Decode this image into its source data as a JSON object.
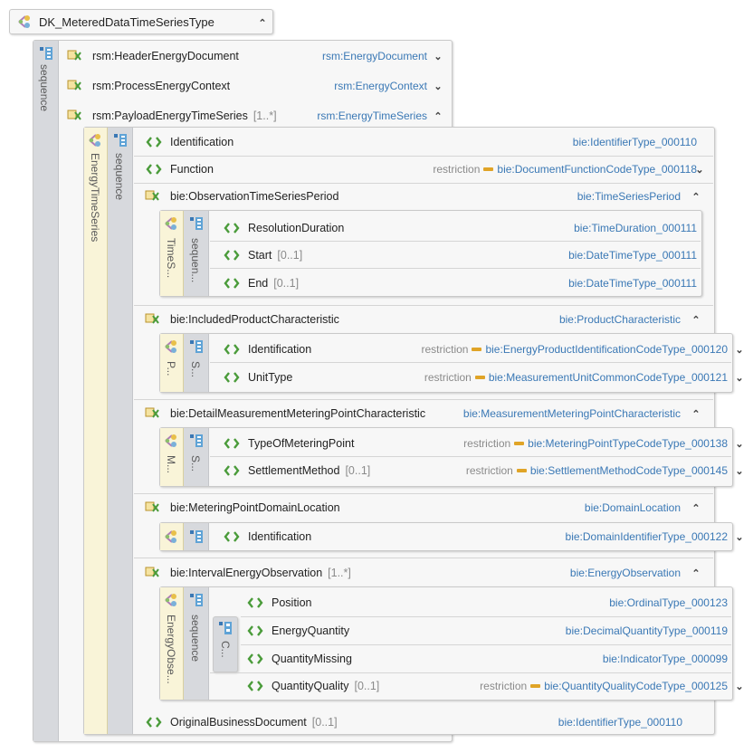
{
  "root": {
    "title": "DK_MeteredDataTimeSeriesType",
    "compositor": "sequence"
  },
  "top_elements": [
    {
      "name": "rsm:HeaderEnergyDocument",
      "mult": "",
      "type": "rsm:EnergyDocument",
      "chevron": "expand"
    },
    {
      "name": "rsm:ProcessEnergyContext",
      "mult": "",
      "type": "rsm:EnergyContext",
      "chevron": "expand"
    },
    {
      "name": "rsm:PayloadEnergyTimeSeries",
      "mult": "[1..*]",
      "type": "rsm:EnergyTimeSeries",
      "chevron": "collapse"
    }
  ],
  "payload": {
    "type_label": "EnergyTimeSeries",
    "compositor": "sequence",
    "rows": [
      {
        "name": "Identification",
        "mult": "",
        "restriction": "",
        "type": "bie:IdentifierType_000110",
        "chevron": ""
      },
      {
        "name": "Function",
        "mult": "",
        "restriction": "restriction",
        "type": "bie:DocumentFunctionCodeType_000118",
        "chevron": "expand"
      },
      {
        "name": "bie:ObservationTimeSeriesPeriod",
        "mult": "",
        "restriction": "",
        "type": "bie:TimeSeriesPeriod",
        "chevron": "collapse"
      }
    ],
    "period": {
      "type_label": "TimeS...",
      "compositor": "sequen...",
      "rows": [
        {
          "name": "ResolutionDuration",
          "mult": "",
          "type": "bie:TimeDuration_000111"
        },
        {
          "name": "Start",
          "mult": "[0..1]",
          "type": "bie:DateTimeType_000111"
        },
        {
          "name": "End",
          "mult": "[0..1]",
          "type": "bie:DateTimeType_000111"
        }
      ]
    },
    "product": {
      "name": "bie:IncludedProductCharacteristic",
      "type": "bie:ProductCharacteristic",
      "type_label": "P...",
      "compositor": "S...",
      "rows": [
        {
          "name": "Identification",
          "mult": "",
          "restriction": "restriction",
          "type": "bie:EnergyProductIdentificationCodeType_000120"
        },
        {
          "name": "UnitType",
          "mult": "",
          "restriction": "restriction",
          "type": "bie:MeasurementUnitCommonCodeType_000121"
        }
      ]
    },
    "metering": {
      "name": "bie:DetailMeasurementMeteringPointCharacteristic",
      "type": "bie:MeasurementMeteringPointCharacteristic",
      "type_label": "M...",
      "compositor": "S...",
      "rows": [
        {
          "name": "TypeOfMeteringPoint",
          "mult": "",
          "restriction": "restriction",
          "type": "bie:MeteringPointTypeCodeType_000138"
        },
        {
          "name": "SettlementMethod",
          "mult": "[0..1]",
          "restriction": "restriction",
          "type": "bie:SettlementMethodCodeType_000145"
        }
      ]
    },
    "domain": {
      "name": "bie:MeteringPointDomainLocation",
      "type": "bie:DomainLocation",
      "row": {
        "name": "Identification",
        "type": "bie:DomainIdentifierType_000122"
      }
    },
    "interval": {
      "name": "bie:IntervalEnergyObservation",
      "mult": "[1..*]",
      "type": "bie:EnergyObservation",
      "type_label": "EnergyObse...",
      "compositor": "sequence",
      "choice": "C...",
      "rows": [
        {
          "name": "Position",
          "mult": "",
          "restriction": "",
          "type": "bie:OrdinalType_000123"
        },
        {
          "name": "EnergyQuantity",
          "mult": "",
          "restriction": "",
          "type": "bie:DecimalQuantityType_000119"
        },
        {
          "name": "QuantityMissing",
          "mult": "",
          "restriction": "",
          "type": "bie:IndicatorType_000099"
        },
        {
          "name": "QuantityQuality",
          "mult": "[0..1]",
          "restriction": "restriction",
          "type": "bie:QuantityQualityCodeType_000125"
        }
      ]
    },
    "original": {
      "name": "OriginalBusinessDocument",
      "mult": "[0..1]",
      "type": "bie:IdentifierType_000110"
    }
  },
  "icons": {
    "complex_type": "complex-type-icon",
    "sequence": "sequence-icon",
    "element": "element-icon",
    "complex_element": "complex-element-icon",
    "expand": "expand-chevron-icon",
    "collapse": "collapse-chevron-icon"
  },
  "colors": {
    "type_link": "#3a78b5",
    "restriction_bar": "#e0a427",
    "type_strip": "#f9f4d8",
    "sequence_strip": "#d7d9dd"
  }
}
